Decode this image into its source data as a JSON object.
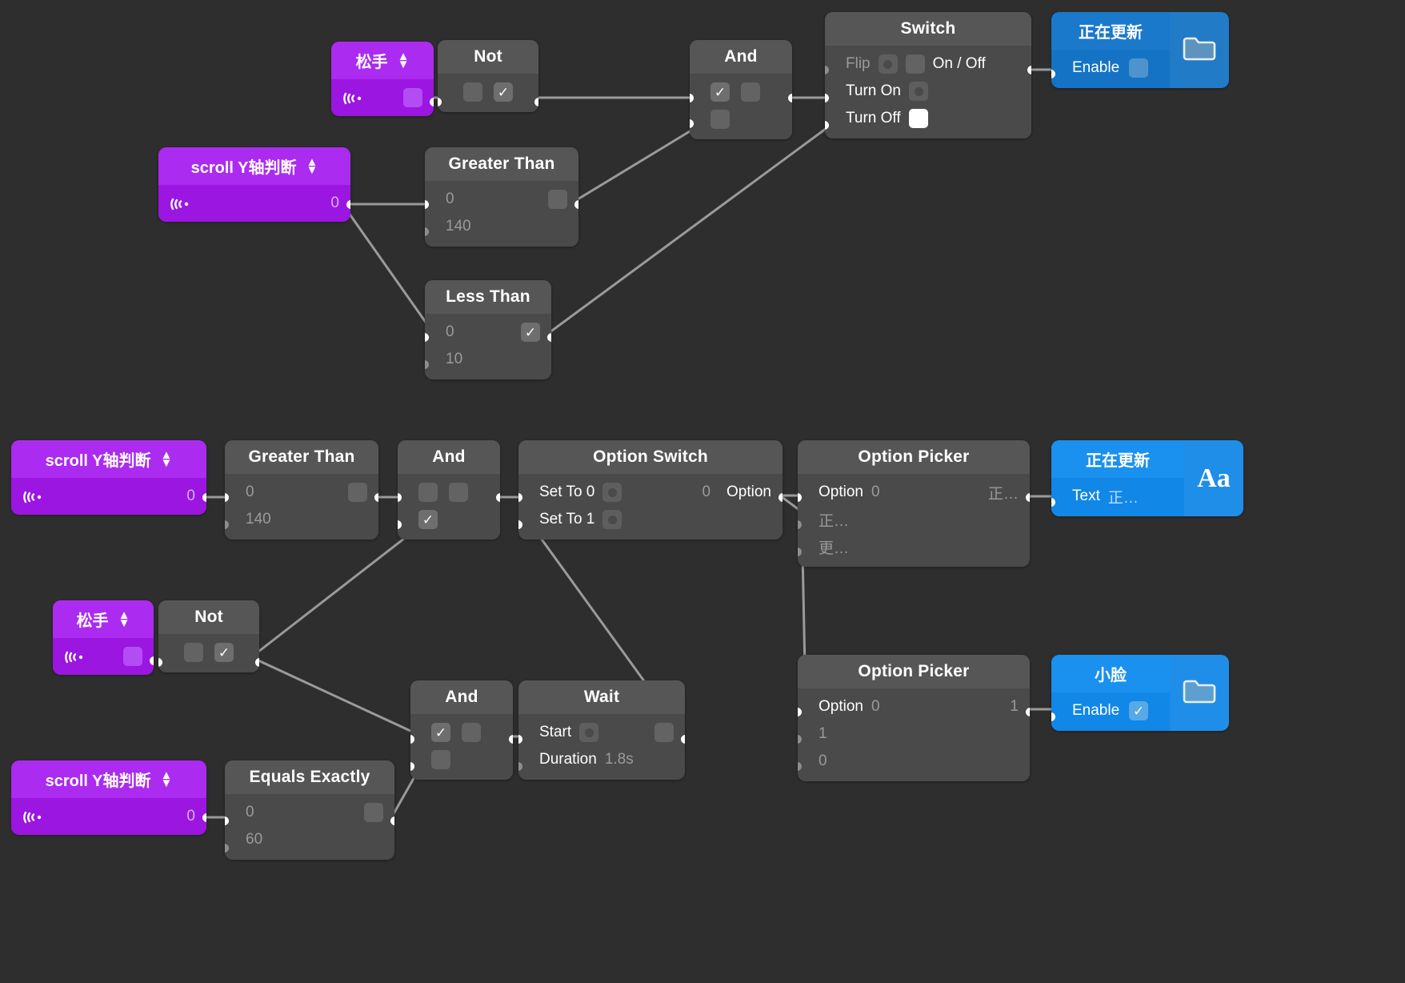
{
  "app": {
    "background": "#2e2e2e",
    "accent_purple": "#9b16e0",
    "accent_blue": "#1473c4",
    "node_grey": "#4a4a4a"
  },
  "nodes": {
    "trigger_release_top": {
      "title": "松手",
      "value": ""
    },
    "not_top": {
      "title": "Not"
    },
    "and_top": {
      "title": "And"
    },
    "switch_top": {
      "title": "Switch",
      "flip": "Flip",
      "on_off": "On / Off",
      "turn_on": "Turn On",
      "turn_off": "Turn Off"
    },
    "target_updating_top": {
      "title": "正在更新",
      "enable": "Enable",
      "icon": "folder-icon"
    },
    "scroll_y_top": {
      "title": "scroll Y轴判断",
      "value": "0"
    },
    "greater_than_top": {
      "title": "Greater Than",
      "a": "0",
      "b": "140"
    },
    "less_than_top": {
      "title": "Less Than",
      "a": "0",
      "b": "10"
    },
    "scroll_y_mid": {
      "title": "scroll Y轴判断",
      "value": "0"
    },
    "greater_than_mid": {
      "title": "Greater Than",
      "a": "0",
      "b": "140"
    },
    "and_mid": {
      "title": "And"
    },
    "option_switch": {
      "title": "Option Switch",
      "set_to_0": "Set To 0",
      "set_to_1": "Set To 1",
      "option_out_value": "0",
      "option_out_label": "Option"
    },
    "option_picker_top": {
      "title": "Option Picker",
      "option_label": "Option",
      "option_value": "0",
      "out_value": "正…",
      "items": [
        "正…",
        "更…"
      ]
    },
    "target_updating_mid": {
      "title": "正在更新",
      "text_label": "Text",
      "text_value": "正…",
      "icon": "aa-text-icon"
    },
    "trigger_release_mid": {
      "title": "松手"
    },
    "not_mid": {
      "title": "Not"
    },
    "and_bottom": {
      "title": "And"
    },
    "wait": {
      "title": "Wait",
      "start": "Start",
      "duration_label": "Duration",
      "duration_value": "1.8s"
    },
    "option_picker_bottom": {
      "title": "Option Picker",
      "option_label": "Option",
      "option_value": "0",
      "out_value": "1",
      "items": [
        "1",
        "0"
      ]
    },
    "target_small_face": {
      "title": "小脸",
      "enable": "Enable",
      "icon": "folder-icon"
    },
    "scroll_y_bottom": {
      "title": "scroll Y轴判断",
      "value": "0"
    },
    "equals_exactly": {
      "title": "Equals Exactly",
      "a": "0",
      "b": "60"
    }
  }
}
